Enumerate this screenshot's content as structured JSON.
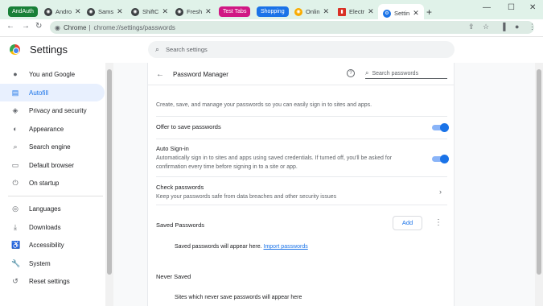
{
  "tabs": {
    "groups": [
      {
        "label": "AndAuth",
        "color": "#188038"
      },
      {
        "label": "Test Tabs",
        "color": "#d01884"
      },
      {
        "label": "Shopping",
        "color": "#1a73e8"
      }
    ],
    "items": [
      {
        "title": "Andro",
        "icon": "android-icon"
      },
      {
        "title": "Sams",
        "icon": "samsung-icon"
      },
      {
        "title": "ShiftC",
        "icon": "shift-icon"
      },
      {
        "title": "Fresh",
        "icon": "fresh-icon"
      },
      {
        "title": "Onlin",
        "icon": "online-icon"
      },
      {
        "title": "Electr",
        "icon": "electronics-icon"
      },
      {
        "title": "Settin",
        "icon": "settings-icon",
        "active": true
      }
    ]
  },
  "toolbar": {
    "scheme": "Chrome",
    "url": "chrome://settings/passwords"
  },
  "header": {
    "title": "Settings",
    "search_placeholder": "Search settings"
  },
  "sidebar": {
    "items": [
      {
        "label": "You and Google",
        "icon": "person-icon"
      },
      {
        "label": "Autofill",
        "icon": "autofill-icon",
        "active": true
      },
      {
        "label": "Privacy and security",
        "icon": "shield-icon"
      },
      {
        "label": "Appearance",
        "icon": "palette-icon"
      },
      {
        "label": "Search engine",
        "icon": "search-icon"
      },
      {
        "label": "Default browser",
        "icon": "browser-icon"
      },
      {
        "label": "On startup",
        "icon": "power-icon"
      },
      {
        "label": "Languages",
        "icon": "globe-icon"
      },
      {
        "label": "Downloads",
        "icon": "download-icon"
      },
      {
        "label": "Accessibility",
        "icon": "accessibility-icon"
      },
      {
        "label": "System",
        "icon": "wrench-icon"
      },
      {
        "label": "Reset settings",
        "icon": "reset-icon"
      }
    ]
  },
  "password_manager": {
    "title": "Password Manager",
    "search_placeholder": "Search passwords",
    "intro": "Create, save, and manage your passwords so you can easily sign in to sites and apps.",
    "offer_to_save": {
      "label": "Offer to save passwords",
      "enabled": true
    },
    "auto_signin": {
      "label": "Auto Sign-in",
      "description": "Automatically sign in to sites and apps using saved credentials. If turned off, you'll be asked for confirmation every time before signing in to a site or app.",
      "enabled": true
    },
    "check_passwords": {
      "label": "Check passwords",
      "description": "Keep your passwords safe from data breaches and other security issues"
    },
    "saved_passwords": {
      "label": "Saved Passwords",
      "add_label": "Add",
      "empty_text": "Saved passwords will appear here.",
      "import_link": "Import passwords"
    },
    "never_saved": {
      "label": "Never Saved",
      "empty_text": "Sites which never save passwords will appear here"
    }
  }
}
